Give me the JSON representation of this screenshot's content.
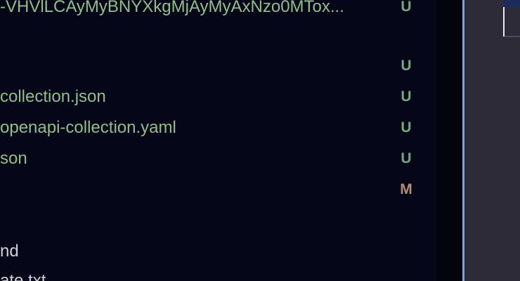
{
  "explorer": {
    "files": [
      {
        "name": "-VHVlLCAyMyBNYXkgMjAyMyAxNzo0MTox...",
        "status": "U",
        "kind": "untracked"
      },
      {
        "name": "",
        "status": "U",
        "kind": "untracked"
      },
      {
        "name": "collection.json",
        "status": "U",
        "kind": "untracked"
      },
      {
        "name": "openapi-collection.yaml",
        "status": "U",
        "kind": "untracked"
      },
      {
        "name": "son",
        "status": "U",
        "kind": "untracked"
      },
      {
        "name": "",
        "status": "M",
        "kind": "modified"
      },
      {
        "name": "nd",
        "status": "",
        "kind": "plain"
      },
      {
        "name": "ate.txt",
        "status": "",
        "kind": "plain"
      }
    ]
  },
  "colors": {
    "background": "#060619",
    "untracked": "#8fbf8b",
    "modified": "#c6a384",
    "sash": "#7f9fd6",
    "editor": "#2e2b39"
  }
}
